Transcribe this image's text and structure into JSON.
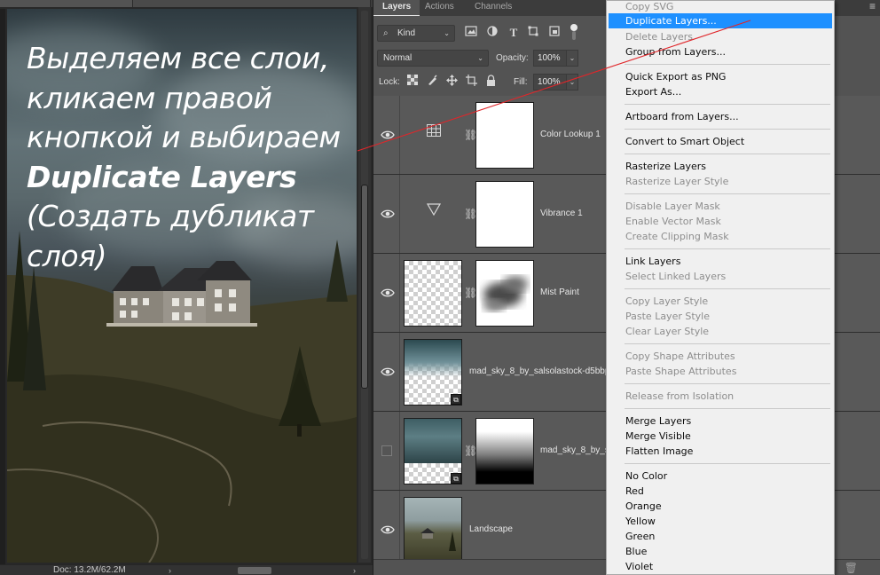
{
  "canvas": {
    "overlay": {
      "line1": "Выделяем все слои,",
      "line2": "кликаем правой",
      "line3": "кнопкой и выбираем",
      "line4_bold": "Duplicate Layers",
      "line5": "(Создать дубликат",
      "line6": "слоя)"
    },
    "status": {
      "doc_info": "Doc: 13.2M/62.2M",
      "chevron": "›",
      "right_chevron": "›"
    }
  },
  "layers_panel": {
    "tabs": [
      {
        "label": "Layers"
      },
      {
        "label": "Actions"
      },
      {
        "label": "Channels"
      }
    ],
    "menu_icon": "≡",
    "filter": {
      "kind_label": "Kind",
      "kind_icon": "⌕",
      "caret": "⌄",
      "icons": [
        "image-filter-icon",
        "adjustment-filter-icon",
        "type-filter-icon",
        "shape-filter-icon",
        "smart-object-filter-icon"
      ]
    },
    "blend": {
      "mode": "Normal",
      "opacity_label": "Opacity:",
      "opacity_value": "100%",
      "fill_label": "Fill:",
      "fill_value": "100%",
      "caret": "⌄"
    },
    "lock": {
      "label": "Lock:"
    },
    "layers": [
      {
        "name": "Color Lookup 1",
        "visible": true,
        "kind": "adjustment",
        "icon": "grid-icon"
      },
      {
        "name": "Vibrance 1",
        "visible": true,
        "kind": "adjustment",
        "icon": "triangle-icon"
      },
      {
        "name": "Mist Paint",
        "visible": true,
        "kind": "pixel-with-mask"
      },
      {
        "name": "mad_sky_8_by_salsolastock-d5bbp",
        "visible": true,
        "kind": "smart-object"
      },
      {
        "name": "mad_sky_8_by_s",
        "visible": false,
        "kind": "smart-object-with-mask"
      },
      {
        "name": "Landscape",
        "visible": true,
        "kind": "pixel"
      }
    ]
  },
  "context_menu": {
    "items": [
      {
        "label": "Copy SVG",
        "disabled": true
      },
      {
        "label": "Duplicate Layers...",
        "highlighted": true
      },
      {
        "label": "Delete Layers",
        "disabled": true
      },
      {
        "label": "Group from Layers..."
      },
      {
        "label": "Quick Export as PNG"
      },
      {
        "label": "Export As..."
      },
      {
        "label": "Artboard from Layers..."
      },
      {
        "label": "Convert to Smart Object"
      },
      {
        "label": "Rasterize Layers"
      },
      {
        "label": "Rasterize Layer Style",
        "disabled": true
      },
      {
        "label": "Disable Layer Mask",
        "disabled": true
      },
      {
        "label": "Enable Vector Mask",
        "disabled": true
      },
      {
        "label": "Create Clipping Mask",
        "disabled": true
      },
      {
        "label": "Link Layers"
      },
      {
        "label": "Select Linked Layers",
        "disabled": true
      },
      {
        "label": "Copy Layer Style",
        "disabled": true
      },
      {
        "label": "Paste Layer Style",
        "disabled": true
      },
      {
        "label": "Clear Layer Style",
        "disabled": true
      },
      {
        "label": "Copy Shape Attributes",
        "disabled": true
      },
      {
        "label": "Paste Shape Attributes",
        "disabled": true
      },
      {
        "label": "Release from Isolation",
        "disabled": true
      },
      {
        "label": "Merge Layers"
      },
      {
        "label": "Merge Visible"
      },
      {
        "label": "Flatten Image"
      },
      {
        "label": "No Color"
      },
      {
        "label": "Red"
      },
      {
        "label": "Orange"
      },
      {
        "label": "Yellow"
      },
      {
        "label": "Green"
      },
      {
        "label": "Blue"
      },
      {
        "label": "Violet"
      }
    ]
  },
  "colors": {
    "menu_highlight": "#1e90ff",
    "panel_bg": "#535353",
    "annotation_line": "#e0262a"
  }
}
